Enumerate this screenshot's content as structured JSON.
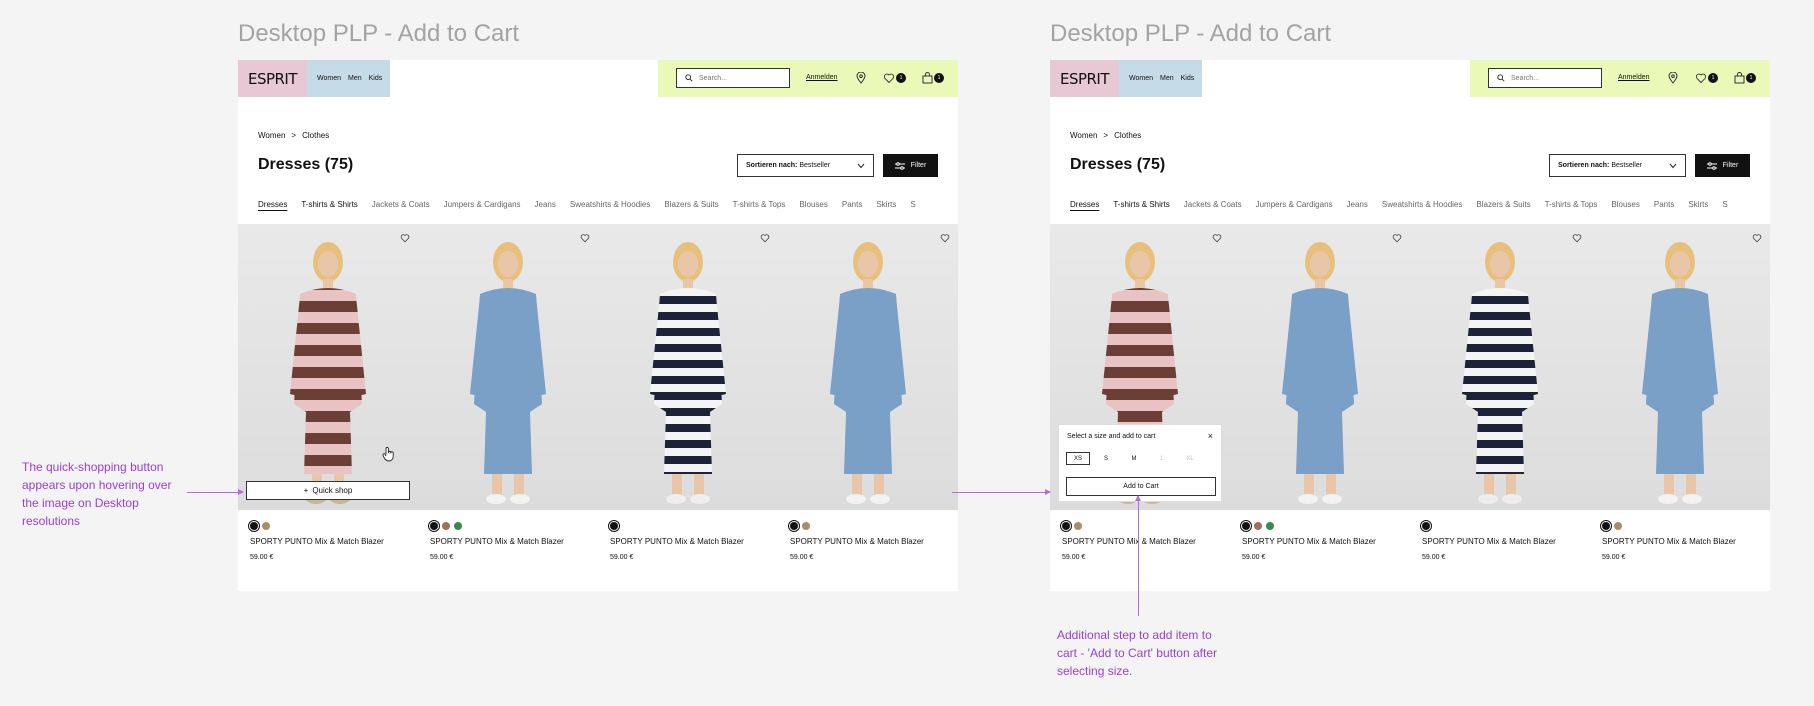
{
  "frames": [
    {
      "title": "Desktop PLP - Add to Cart"
    },
    {
      "title": "Desktop PLP - Add to Cart"
    }
  ],
  "header": {
    "logo": "ESPRIT",
    "nav": [
      "Women",
      "Men",
      "Kids"
    ],
    "search_placeholder": "Search...",
    "login": "Anmelden",
    "wishlist_count": "1",
    "cart_count": "1"
  },
  "breadcrumb": [
    "Women",
    ">",
    "Clothes"
  ],
  "page_title": "Dresses (75)",
  "sort": {
    "label": "Sortieren nach:",
    "value": "Bestseller"
  },
  "filter_label": "Filter",
  "categories": [
    "Dresses",
    "T-shirts & Shirts",
    "Jackets & Coats",
    "Jumpers & Cardigans",
    "Jeans",
    "Sweatshirts & Hoodies",
    "Blazers & Suits",
    "T-shirts & Tops",
    "Blouses",
    "Pants",
    "Skirts",
    "S"
  ],
  "products": [
    {
      "name": "SPORTY PUNTO Mix & Match Blazer",
      "price": "59.00 €",
      "swatches": [
        "#111111",
        "#a88d6a"
      ],
      "dress": "stripes-rose"
    },
    {
      "name": "SPORTY PUNTO Mix & Match Blazer",
      "price": "59.00 €",
      "swatches": [
        "#111111",
        "#a0705a",
        "#3a8a4a"
      ],
      "dress": "denim"
    },
    {
      "name": "SPORTY PUNTO Mix & Match Blazer",
      "price": "59.00 €",
      "swatches": [
        "#111111"
      ],
      "dress": "stripes-navy"
    },
    {
      "name": "SPORTY PUNTO Mix & Match Blazer",
      "price": "59.00 €",
      "swatches": [
        "#111111",
        "#a88d6a"
      ],
      "dress": "denim"
    }
  ],
  "quick_shop_label": "Quick shop",
  "size_panel": {
    "title": "Select a size and add to cart",
    "sizes": [
      "XS",
      "S",
      "M",
      "L",
      "XL"
    ],
    "selected": "XS",
    "available": [
      "XS",
      "S",
      "M"
    ],
    "add_to_cart": "Add to Cart"
  },
  "annotations": {
    "left": "The quick-shopping button appears upon hovering over the image on Desktop resolutions",
    "bottom": "Additional step to add item to cart - 'Add to Cart' button after selecting size."
  },
  "colors": {
    "annotation": "#9b3fd4",
    "logo_bg": "#e9c8d6",
    "nav_bg": "#c5dbe8",
    "util_bg": "#eaf8b8"
  }
}
